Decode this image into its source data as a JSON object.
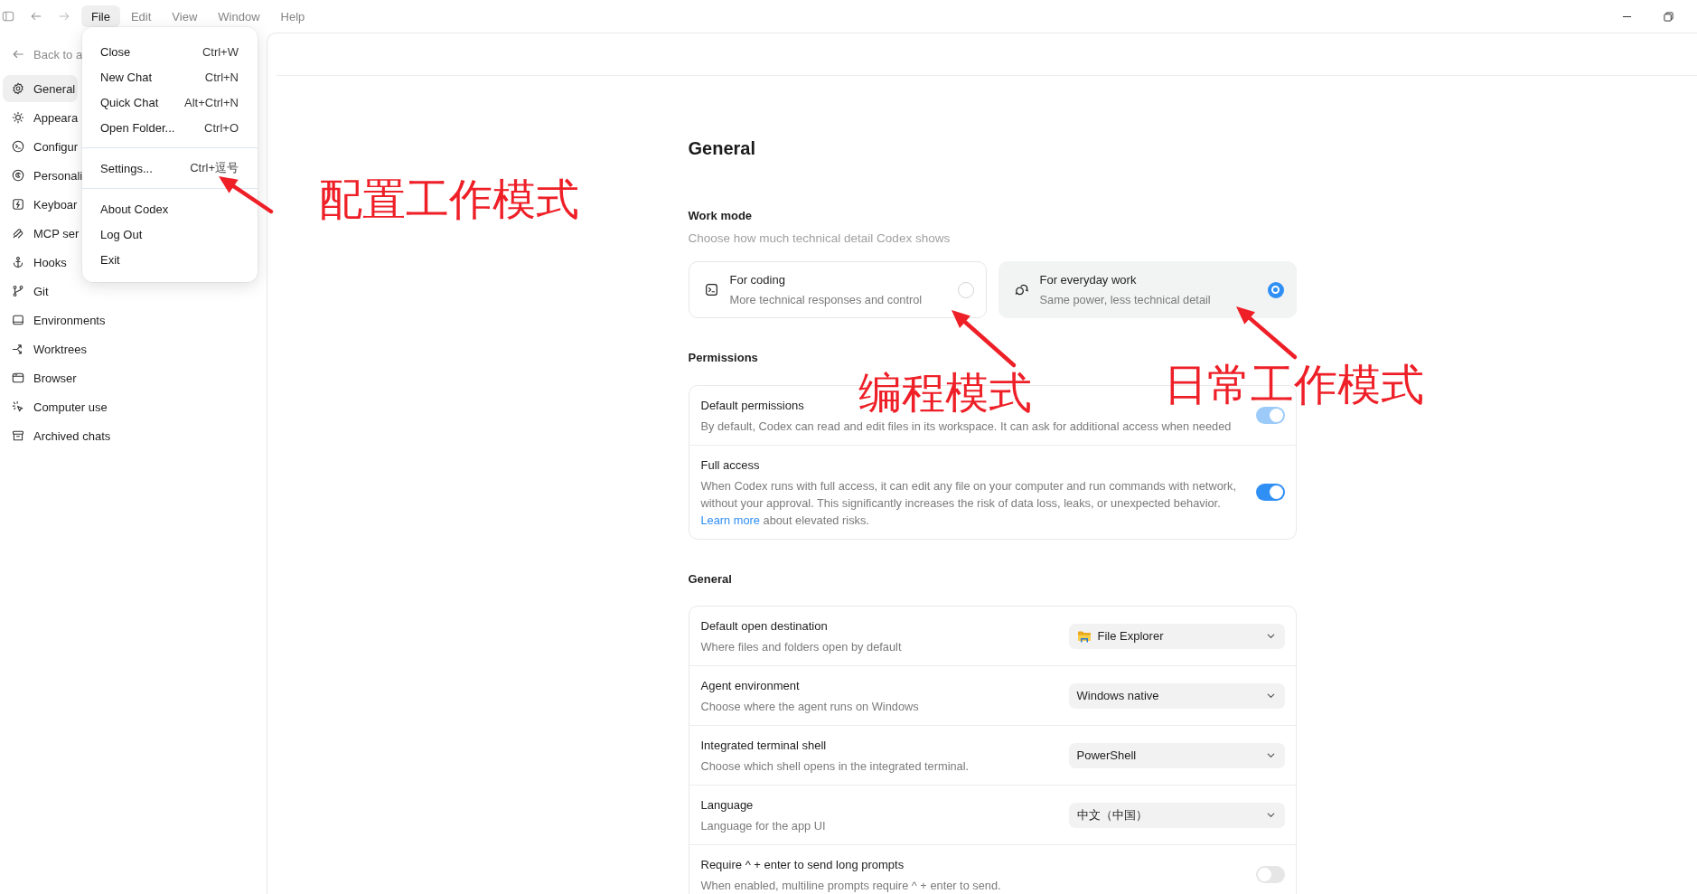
{
  "menu_bar": {
    "items": [
      {
        "label": "File",
        "selected": true
      },
      {
        "label": "Edit",
        "selected": false
      },
      {
        "label": "View",
        "selected": false
      },
      {
        "label": "Window",
        "selected": false
      },
      {
        "label": "Help",
        "selected": false
      }
    ]
  },
  "file_menu": {
    "groups": [
      [
        {
          "label": "Close",
          "shortcut": "Ctrl+W"
        },
        {
          "label": "New Chat",
          "shortcut": "Ctrl+N"
        },
        {
          "label": "Quick Chat",
          "shortcut": "Alt+Ctrl+N"
        },
        {
          "label": "Open Folder...",
          "shortcut": "Ctrl+O"
        }
      ],
      [
        {
          "label": "Settings...",
          "shortcut": "Ctrl+逗号"
        }
      ],
      [
        {
          "label": "About Codex"
        },
        {
          "label": "Log Out"
        },
        {
          "label": "Exit"
        }
      ]
    ]
  },
  "sidebar": {
    "back_link": "Back to a",
    "items": [
      {
        "label": "General",
        "selected": true
      },
      {
        "label": "Appeara",
        "selected": false
      },
      {
        "label": "Configur",
        "selected": false
      },
      {
        "label": "Personali",
        "selected": false
      },
      {
        "label": "Keyboar",
        "selected": false
      },
      {
        "label": "MCP ser",
        "selected": false
      },
      {
        "label": "Hooks",
        "selected": false
      },
      {
        "label": "Git",
        "selected": false
      },
      {
        "label": "Environments",
        "selected": false
      },
      {
        "label": "Worktrees",
        "selected": false
      },
      {
        "label": "Browser",
        "selected": false
      },
      {
        "label": "Computer use",
        "selected": false
      },
      {
        "label": "Archived chats",
        "selected": false
      }
    ]
  },
  "page": {
    "title": "General",
    "work_mode": {
      "title": "Work mode",
      "subtitle": "Choose how much technical detail Codex shows",
      "options": [
        {
          "label": "For coding",
          "description": "More technical responses and control",
          "selected": false
        },
        {
          "label": "For everyday work",
          "description": "Same power, less technical detail",
          "selected": true
        }
      ]
    },
    "permissions": {
      "title": "Permissions",
      "rows": [
        {
          "title": "Default permissions",
          "description": "By default, Codex can read and edit files in its workspace. It can ask for additional access when needed",
          "on": true,
          "disabled": true
        },
        {
          "title": "Full access",
          "description": "When Codex runs with full access, it can edit any file on your computer and run commands with network, without your approval. This significantly increases the risk of data loss, leaks, or unexpected behavior.",
          "link": "Learn more",
          "description_end": "about elevated risks.",
          "on": true,
          "disabled": false
        }
      ]
    },
    "general": {
      "title": "General",
      "rows": [
        {
          "kind": "select",
          "title": "Default open destination",
          "description": "Where files and folders open by default",
          "value": "File Explorer"
        },
        {
          "kind": "select",
          "title": "Agent environment",
          "description": "Choose where the agent runs on Windows",
          "value": "Windows native"
        },
        {
          "kind": "select",
          "title": "Integrated terminal shell",
          "description": "Choose which shell opens in the integrated terminal.",
          "value": "PowerShell"
        },
        {
          "kind": "select",
          "title": "Language",
          "description": "Language for the app UI",
          "value": "中文（中国）"
        },
        {
          "kind": "toggle",
          "title": "Require ^ + enter to send long prompts",
          "description": "When enabled, multiline prompts require ^ + enter to send.",
          "on": false
        }
      ]
    }
  },
  "annotations": [
    {
      "text": "配置工作模式"
    },
    {
      "text": "编程模式"
    },
    {
      "text": "日常工作模式"
    }
  ]
}
